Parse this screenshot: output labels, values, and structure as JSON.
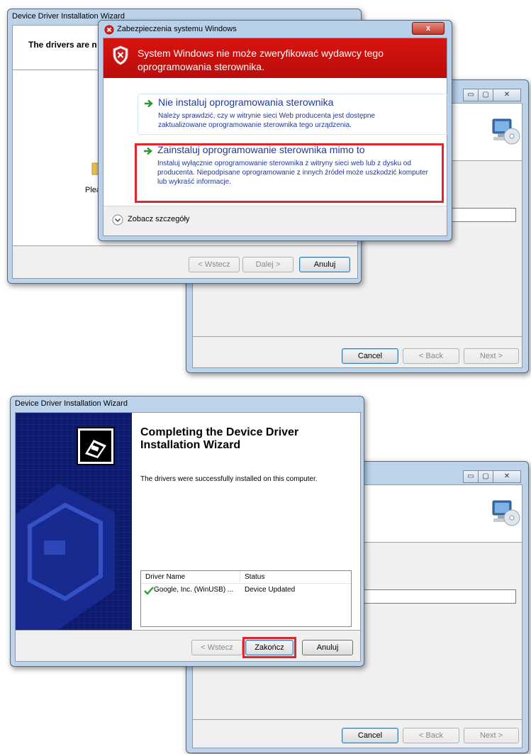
{
  "colors": {
    "accent_red": "#e0252b",
    "security_banner": "#c8110f",
    "wizard_navy": "#0d1a6b",
    "link_blue": "#1f3a9a",
    "arrow_green": "#2b9a2b"
  },
  "top": {
    "wizard": {
      "title": "Device Driver Installation Wizard",
      "header_text": "The drivers are n",
      "please_text": "Plea",
      "buttons": {
        "back": "< Wstecz",
        "next": "Dalej >",
        "cancel": "Anuluj"
      }
    },
    "bg_window": {
      "buttons": {
        "cancel": "Cancel",
        "back": "< Back",
        "next": "Next >"
      }
    },
    "security": {
      "title": "Zabezpieczenia systemu Windows",
      "close_label": "x",
      "banner_text": "System Windows nie może zweryfikować wydawcy tego oprogramowania sterownika.",
      "option1": {
        "title": "Nie instaluj oprogramowania sterownika",
        "desc": "Należy sprawdzić, czy w witrynie sieci Web producenta jest dostępne zaktualizowane oprogramowanie sterownika tego urządzenia."
      },
      "option2": {
        "title": "Zainstaluj oprogramowanie sterownika mimo to",
        "desc": "Instaluj wyłącznie oprogramowanie sterownika z witryny sieci web lub z dysku od producenta. Niepodpisane oprogramowanie z innych źródeł może uszkodzić komputer lub wykraść informacje."
      },
      "details_label": "Zobacz szczegóły"
    }
  },
  "bottom": {
    "wizard": {
      "title": "Device Driver Installation Wizard",
      "heading": "Completing the Device Driver Installation Wizard",
      "message": "The drivers were successfully installed on this computer.",
      "table": {
        "headers": [
          "Driver Name",
          "Status"
        ],
        "rows": [
          {
            "name": "Google, Inc. (WinUSB) ...",
            "status": "Device Updated"
          }
        ]
      },
      "buttons": {
        "back": "< Wstecz",
        "finish": "Zakończ",
        "cancel": "Anuluj"
      }
    },
    "bg_window": {
      "buttons": {
        "cancel": "Cancel",
        "back": "< Back",
        "next": "Next >"
      }
    }
  }
}
